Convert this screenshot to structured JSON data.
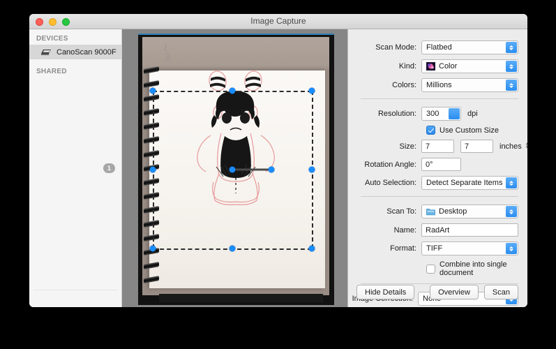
{
  "window": {
    "title": "Image Capture",
    "traffic_lights": [
      "close",
      "minimize",
      "maximize"
    ]
  },
  "sidebar": {
    "sections": [
      {
        "header": "DEVICES",
        "items": [
          {
            "label": "CanoScan 9000F",
            "icon": "scanner-icon",
            "selected": true,
            "badge": ""
          }
        ]
      },
      {
        "header": "SHARED",
        "items": []
      }
    ],
    "shared_badge": "1"
  },
  "preview": {
    "selection": {
      "handles": 8,
      "center_handle": true,
      "rotation_bar": true
    }
  },
  "options": {
    "scan_mode": {
      "label": "Scan Mode:",
      "value": "Flatbed"
    },
    "kind": {
      "label": "Kind:",
      "value": "Color",
      "icon": "color-swatch-icon"
    },
    "colors": {
      "label": "Colors:",
      "value": "Millions"
    },
    "resolution": {
      "label": "Resolution:",
      "value": "300",
      "unit": "dpi"
    },
    "use_custom_size": {
      "label": "Use Custom Size",
      "checked": true
    },
    "size": {
      "label": "Size:",
      "width": "7",
      "height": "7",
      "unit": "inches"
    },
    "rotation_angle": {
      "label": "Rotation Angle:",
      "value": "0°"
    },
    "auto_selection": {
      "label": "Auto Selection:",
      "value": "Detect Separate Items"
    },
    "scan_to": {
      "label": "Scan To:",
      "value": "Desktop",
      "icon": "folder-icon"
    },
    "name": {
      "label": "Name:",
      "value": "RadArt"
    },
    "format": {
      "label": "Format:",
      "value": "TIFF"
    },
    "combine": {
      "label": "Combine into single document",
      "checked": false
    },
    "image_correction": {
      "label": "Image Correction:",
      "value": "None"
    }
  },
  "buttons": {
    "hide_details": "Hide Details",
    "overview": "Overview",
    "scan": "Scan"
  },
  "colors": {
    "accent": "#2b8ef0",
    "handle": "#1a8cff",
    "window_bg": "#ececec",
    "sidebar_bg": "#f5f5f5",
    "preview_bg": "#868686"
  }
}
